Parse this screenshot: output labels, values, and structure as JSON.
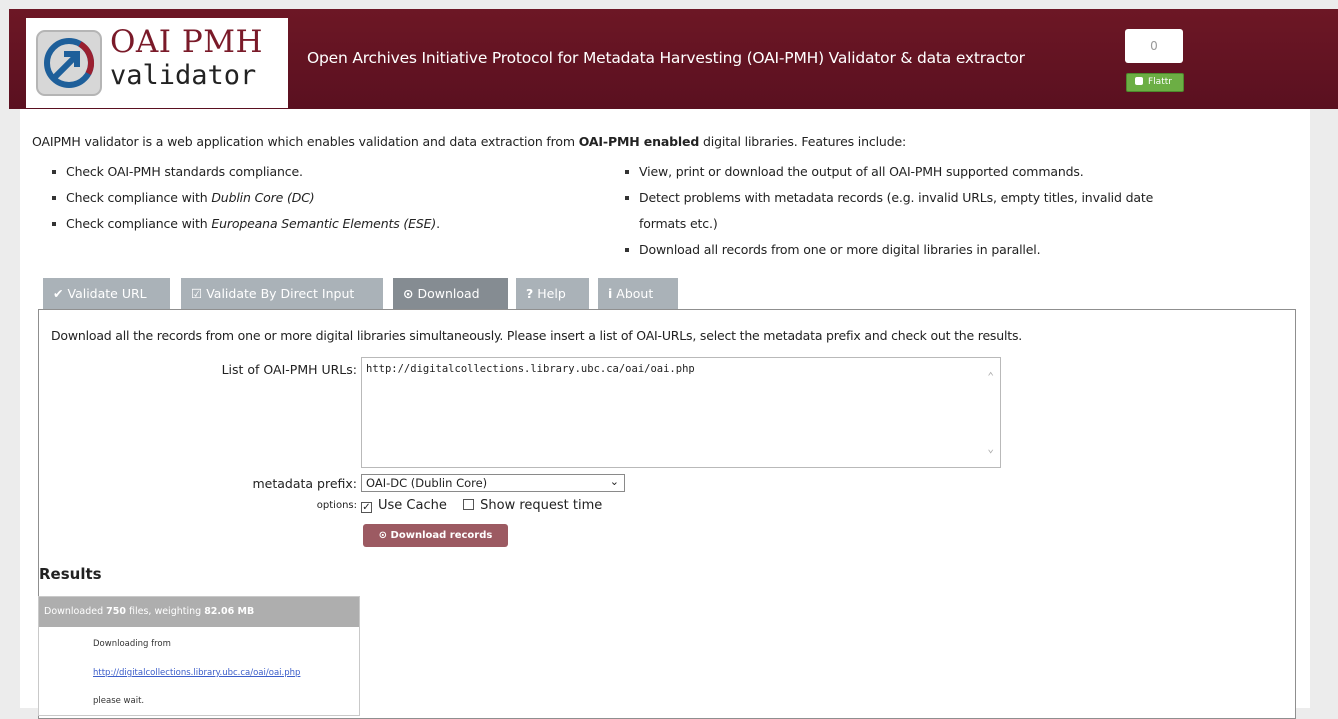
{
  "header": {
    "logo_line1": "OAI PMH",
    "logo_line2": "validator",
    "title": "Open Archives Initiative Protocol for Metadata Harvesting (OAI-PMH) Validator & data extractor",
    "counter": "0",
    "flattr_label": "Flattr"
  },
  "intro": {
    "before": "OAIPMH validator is a web application which enables validation and data extraction from ",
    "bold": "OAI-PMH enabled",
    "after": " digital libraries. Features include:"
  },
  "features_left": [
    {
      "text": "Check OAI-PMH standards compliance.",
      "em": ""
    },
    {
      "text": "Check compliance with ",
      "em": "Dublin Core (DC)"
    },
    {
      "text": "Check compliance with ",
      "em": "Europeana Semantic Elements (ESE)",
      "suffix": "."
    }
  ],
  "features_right": [
    "View, print or download the output of all OAI-PMH supported commands.",
    "Detect problems with metadata records (e.g. invalid URLs, empty titles, invalid date formats etc.)",
    "Download all records from one or more digital libraries in parallel."
  ],
  "tabs": [
    {
      "label": "Validate URL",
      "icon": "check-icon",
      "glyph": "✔"
    },
    {
      "label": "Validate By Direct Input",
      "icon": "checkbox-icon",
      "glyph": "☑"
    },
    {
      "label": "Download",
      "icon": "download-icon",
      "glyph": "⊙"
    },
    {
      "label": "Help",
      "icon": "help-icon",
      "glyph": "?"
    },
    {
      "label": "About",
      "icon": "info-icon",
      "glyph": "i"
    }
  ],
  "active_tab": "Download",
  "download": {
    "description": "Download all the records from one or more digital libraries simultaneously. Please insert a list of OAI-URLs, select the metadata prefix and check out the results.",
    "urls_label": "List of OAI-PMH URLs:",
    "urls_value": "http://digitalcollections.library.ubc.ca/oai/oai.php",
    "prefix_label": "metadata prefix:",
    "prefix_value": "OAI-DC (Dublin Core)",
    "options_label": "options:",
    "use_cache_label": "Use Cache",
    "use_cache_checked": true,
    "show_request_time_label": "Show request time",
    "show_request_time_checked": false,
    "button_label": "Download records"
  },
  "results": {
    "title": "Results",
    "head_prefix": "Downloaded ",
    "files_count": "750",
    "head_middle": " files, weighting ",
    "size": "82.06 MB",
    "line1": "Downloading from",
    "link": "http://digitalcollections.library.ubc.ca/oai/oai.php",
    "line3": "please wait."
  },
  "colors": {
    "header_bg": "#6d1725",
    "tab_bg": "#aab2b8",
    "tab_active_bg": "#858c92",
    "button_bg": "#9c5a62",
    "flattr_green": "#6cae44"
  }
}
